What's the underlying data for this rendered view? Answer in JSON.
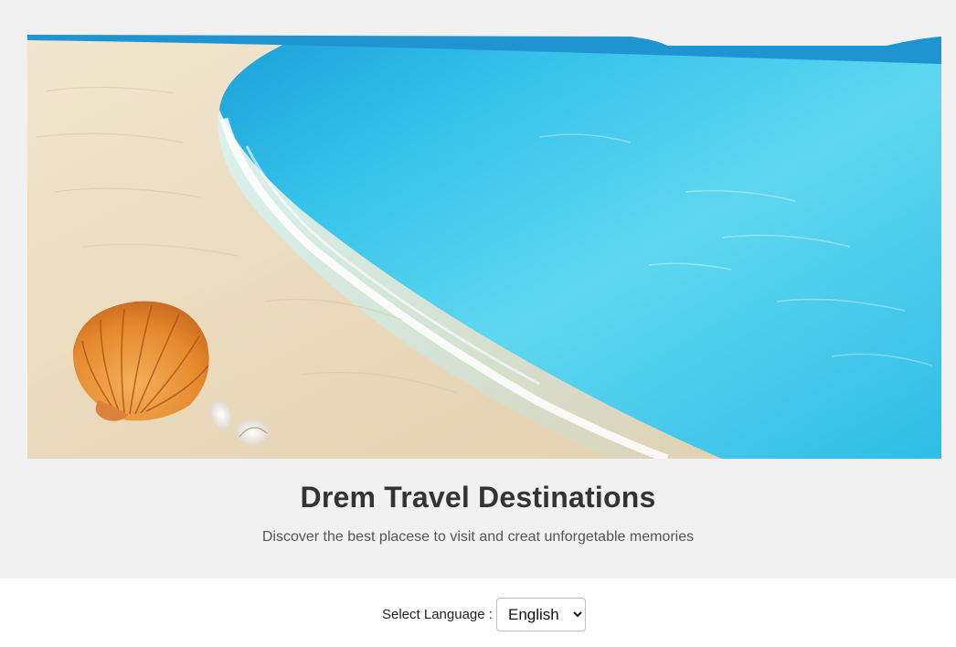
{
  "hero": {
    "image_icon": "beach-with-seashells",
    "title": "Drem Travel Destinations",
    "subtitle": "Discover the best placese to visit and creat unforgetable memories"
  },
  "language": {
    "label": "Select Language :",
    "selected": "English",
    "options": [
      "English"
    ]
  },
  "colors": {
    "hero_background": "#f1f1f1",
    "title": "#333333",
    "subtitle": "#555555",
    "sea": "#3ec8ec",
    "sand": "#ecdfc4"
  }
}
